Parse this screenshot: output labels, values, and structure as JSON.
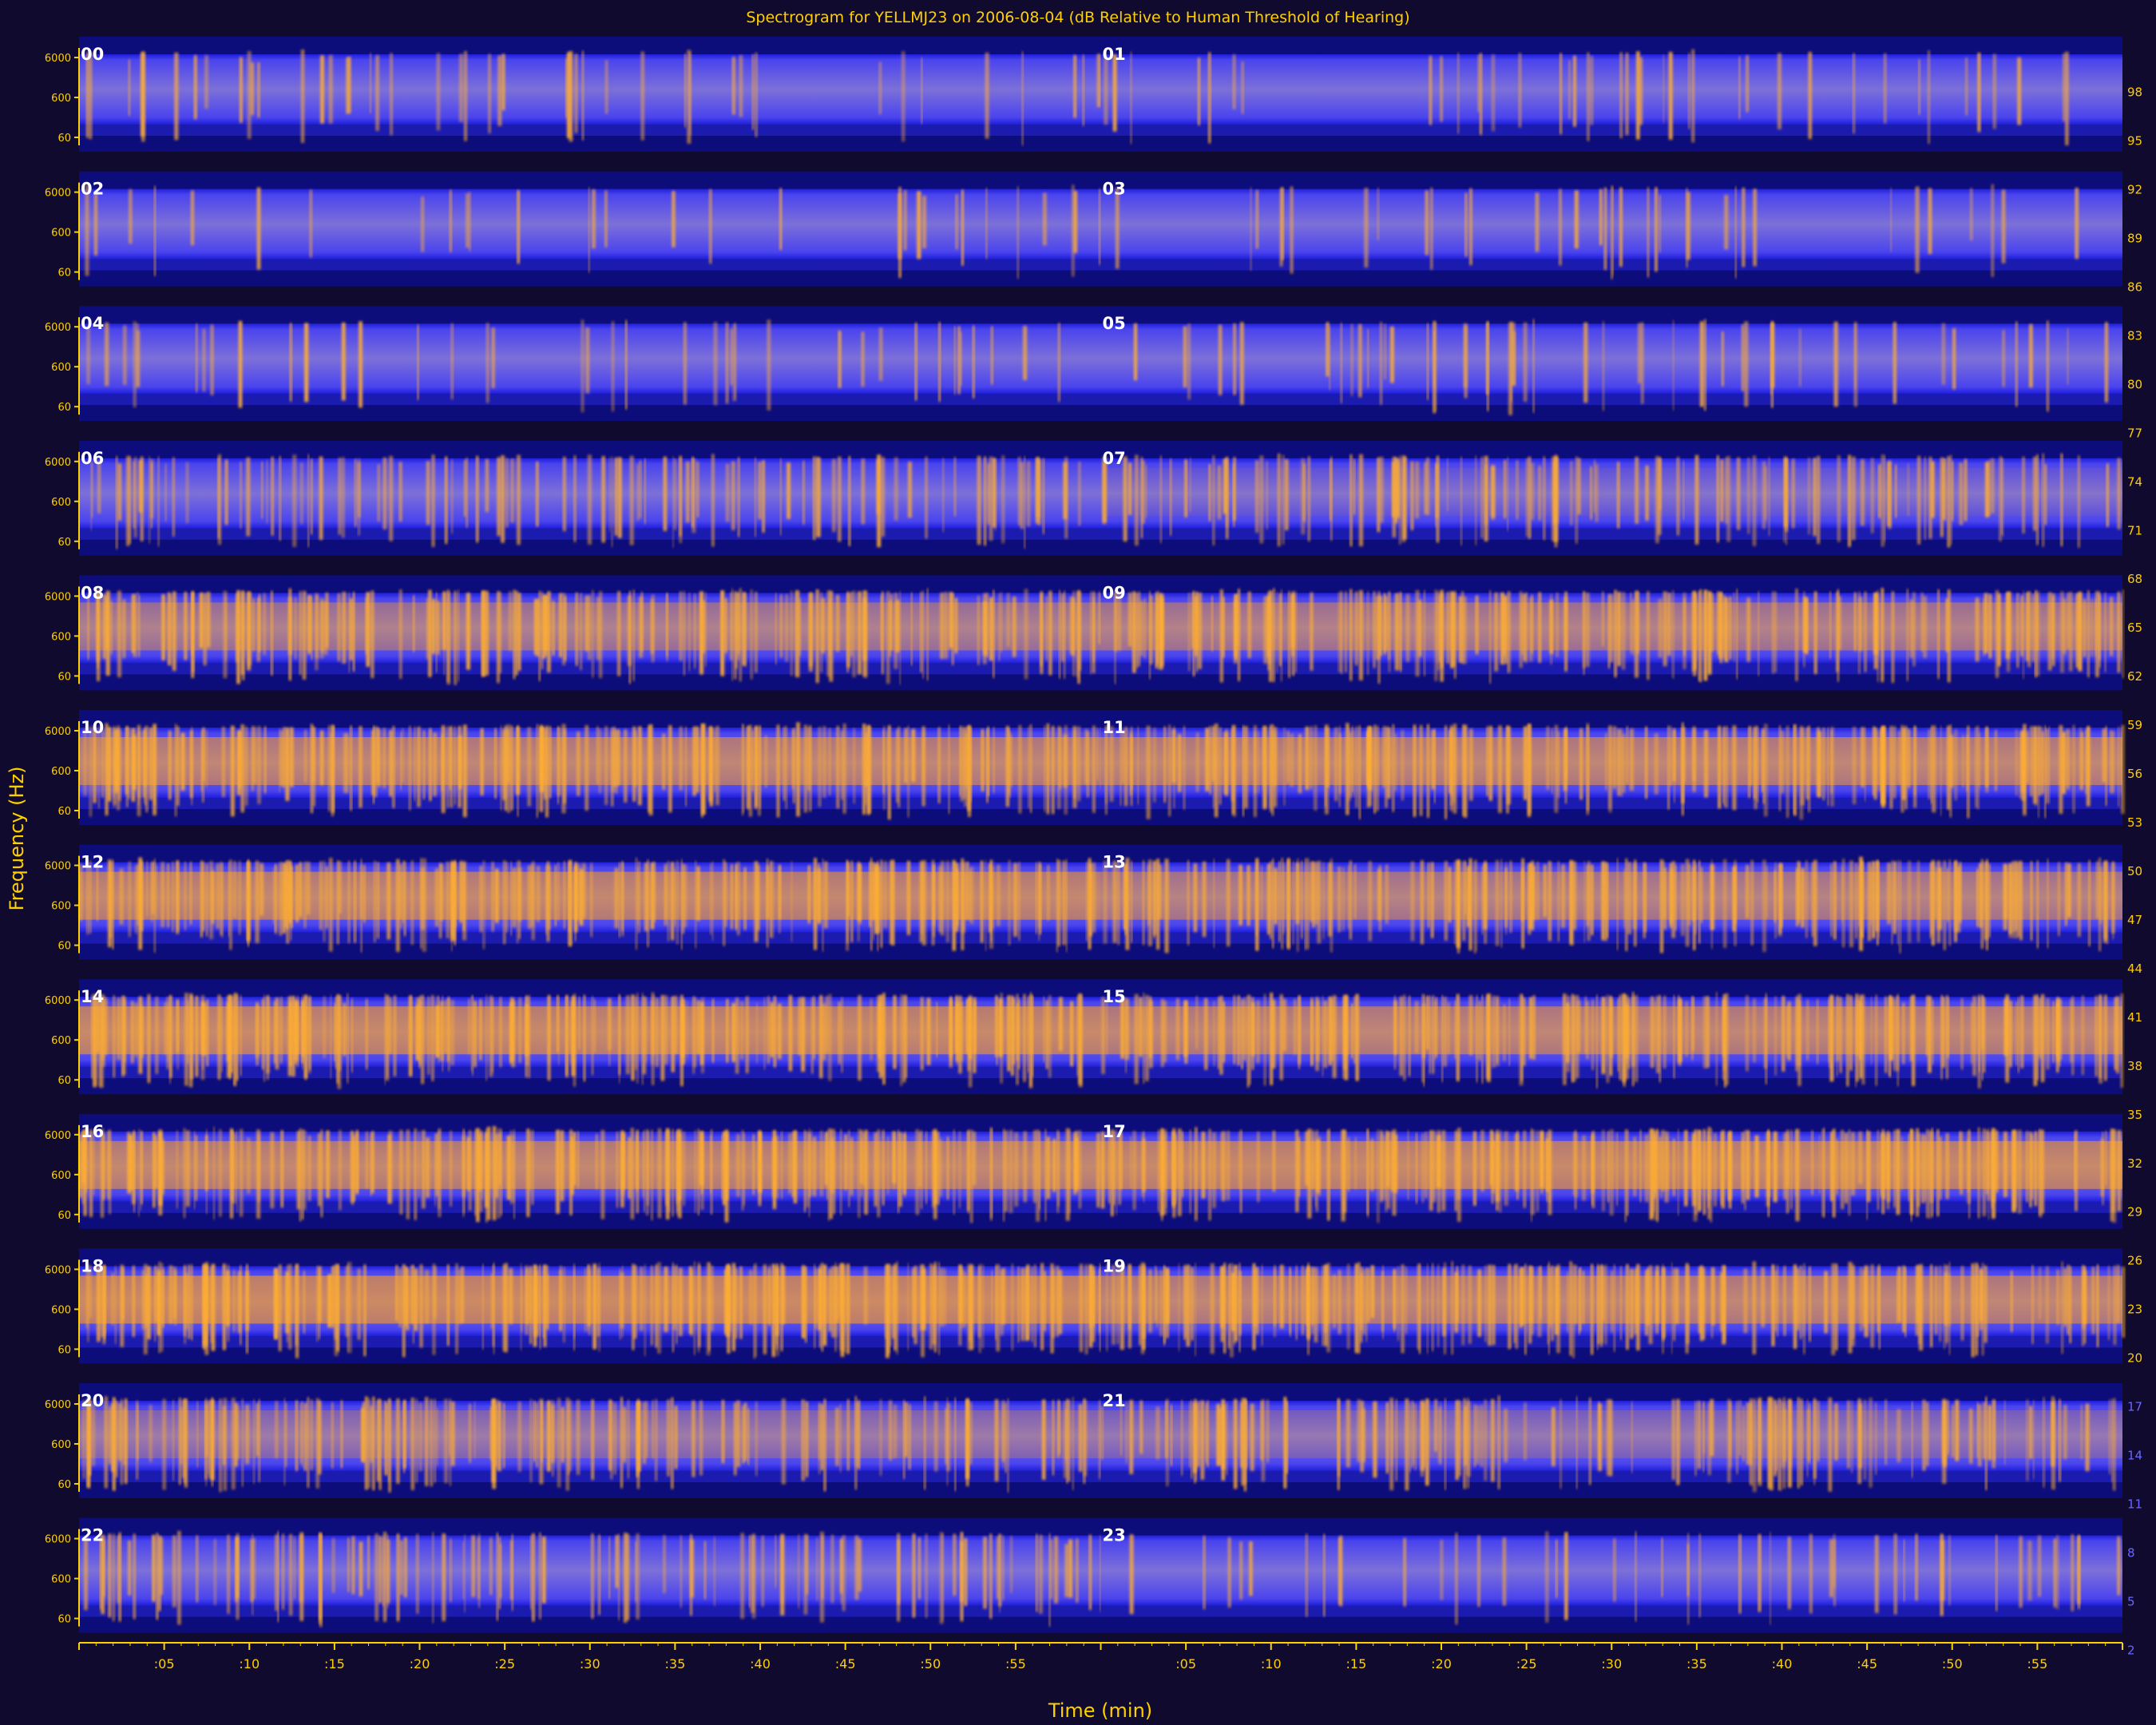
{
  "chart_data": {
    "type": "heatmap",
    "title": "Spectrogram for YELLMJ23 on 2006-08-04 (dB Relative to Human Threshold of Hearing)",
    "xlabel": "Time (min)",
    "ylabel": "Frequency (Hz)",
    "x_tick_labels": [
      ":05",
      ":10",
      ":15",
      ":20",
      ":25",
      ":30",
      ":35",
      ":40",
      ":45",
      ":50",
      ":55",
      "",
      ":05",
      ":10",
      ":15",
      ":20",
      ":25",
      ":30",
      ":35",
      ":40",
      ":45",
      ":50",
      ":55"
    ],
    "y_tick_labels": [
      "6000",
      "600",
      "60"
    ],
    "hour_labels": [
      "00",
      "01",
      "02",
      "03",
      "04",
      "05",
      "06",
      "07",
      "08",
      "09",
      "10",
      "11",
      "12",
      "13",
      "14",
      "15",
      "16",
      "17",
      "18",
      "19",
      "20",
      "21",
      "22",
      "23"
    ],
    "hour_activity": [
      0.15,
      0.12,
      0.08,
      0.1,
      0.12,
      0.18,
      0.45,
      0.55,
      0.8,
      0.82,
      0.9,
      0.9,
      0.92,
      0.85,
      0.95,
      0.9,
      0.92,
      0.95,
      0.97,
      0.9,
      0.7,
      0.65,
      0.5,
      0.15
    ],
    "colorbar_ticks": [
      98,
      95,
      92,
      89,
      86,
      83,
      80,
      77,
      74,
      71,
      68,
      65,
      62,
      59,
      56,
      53,
      50,
      47,
      44,
      41,
      38,
      35,
      32,
      29,
      26,
      23,
      20,
      17,
      14,
      11,
      8,
      5,
      2
    ],
    "colorbar_range": [
      0,
      100
    ],
    "colormap": [
      "#0a0a80",
      "#2b2bff",
      "#8a6fd0",
      "#ffa500"
    ]
  }
}
